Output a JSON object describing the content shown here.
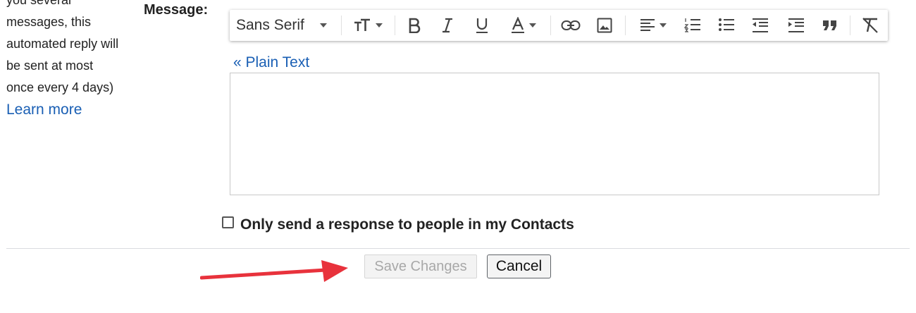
{
  "help": {
    "lines": [
      "you several",
      "messages, this",
      "automated reply will",
      "be sent at most",
      "once every 4 days)"
    ],
    "learn_more": "Learn more"
  },
  "message_label": "Message:",
  "toolbar": {
    "font": "Sans Serif",
    "icons": [
      "font-size-icon",
      "bold-icon",
      "italic-icon",
      "underline-icon",
      "text-color-icon",
      "link-icon",
      "image-icon",
      "align-icon",
      "numbered-list-icon",
      "bulleted-list-icon",
      "indent-less-icon",
      "indent-more-icon",
      "quote-icon",
      "remove-formatting-icon"
    ]
  },
  "plain_text_link": "« Plain Text",
  "editor": {
    "value": ""
  },
  "contacts_checkbox": {
    "label": "Only send a response to people in my Contacts",
    "checked": false
  },
  "buttons": {
    "save": "Save Changes",
    "cancel": "Cancel"
  },
  "colors": {
    "link": "#1a5fb4",
    "arrow": "#e8323c"
  }
}
